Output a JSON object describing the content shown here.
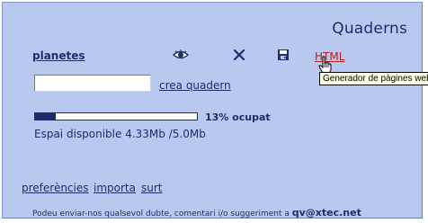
{
  "header": {
    "title": "Quaderns"
  },
  "notebook": {
    "name": "planetes"
  },
  "toolbar": {
    "view_icon": "eye-icon",
    "delete_icon": "close-icon",
    "save_icon": "floppy-disk-icon",
    "html_label": "HTML",
    "tooltip": "Generador de pàgines web"
  },
  "create": {
    "input_value": "",
    "link_label": "crea quadern"
  },
  "usage": {
    "fraction_used": 0.13,
    "percent_label": "13% ocupat",
    "space_text": "Espai disponible 4.33Mb /5.0Mb"
  },
  "footer": {
    "links": [
      "preferències",
      "importa",
      "surt"
    ],
    "contact_text": "Podeu enviar-nos qualsevol dubte, comentari i/o suggeriment a",
    "contact_email": "qv@xtec.net"
  },
  "colors": {
    "panel_bg": "#b8c8ee",
    "text": "#1c2e6e",
    "html_link": "#b22222",
    "tooltip_bg": "#ffffe1"
  }
}
